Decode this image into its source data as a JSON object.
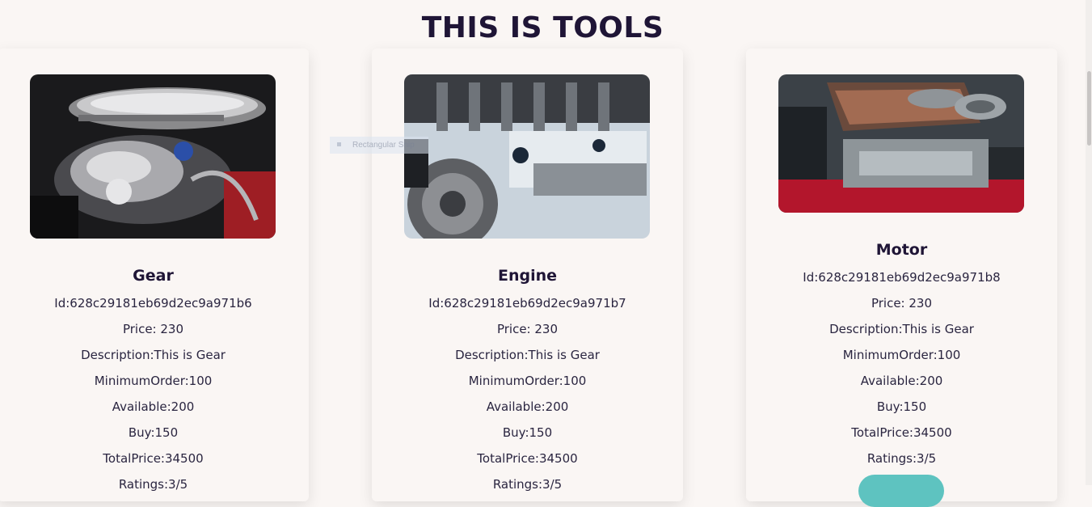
{
  "page": {
    "title": "THIS IS TOOLS"
  },
  "snip_tooltip": {
    "label": "Rectangular Snip"
  },
  "tools": [
    {
      "name": "Gear",
      "id": "Id:628c29181eb69d2ec9a971b6",
      "price": "Price: 230",
      "description": "Description:This is Gear",
      "minimum_order": "MinimumOrder:100",
      "available": "Available:200",
      "buy": "Buy:150",
      "total_price": "TotalPrice:34500",
      "ratings": "Ratings:3/5",
      "image": "engine-chrome-photo"
    },
    {
      "name": "Engine",
      "id": "Id:628c29181eb69d2ec9a971b7",
      "price": "Price: 230",
      "description": "Description:This is Gear",
      "minimum_order": "MinimumOrder:100",
      "available": "Available:200",
      "buy": "Buy:150",
      "total_price": "TotalPrice:34500",
      "ratings": "Ratings:3/5",
      "image": "bmw-engine-gears-photo"
    },
    {
      "name": "Motor",
      "id": "Id:628c29181eb69d2ec9a971b8",
      "price": "Price: 230",
      "description": "Description:This is Gear",
      "minimum_order": "MinimumOrder:100",
      "available": "Available:200",
      "buy": "Buy:150",
      "total_price": "TotalPrice:34500",
      "ratings": "Ratings:3/5",
      "image": "motor-engine-bay-photo"
    }
  ],
  "colors": {
    "background": "#faf6f4",
    "title": "#1f1536",
    "button": "#5ec3c0"
  }
}
